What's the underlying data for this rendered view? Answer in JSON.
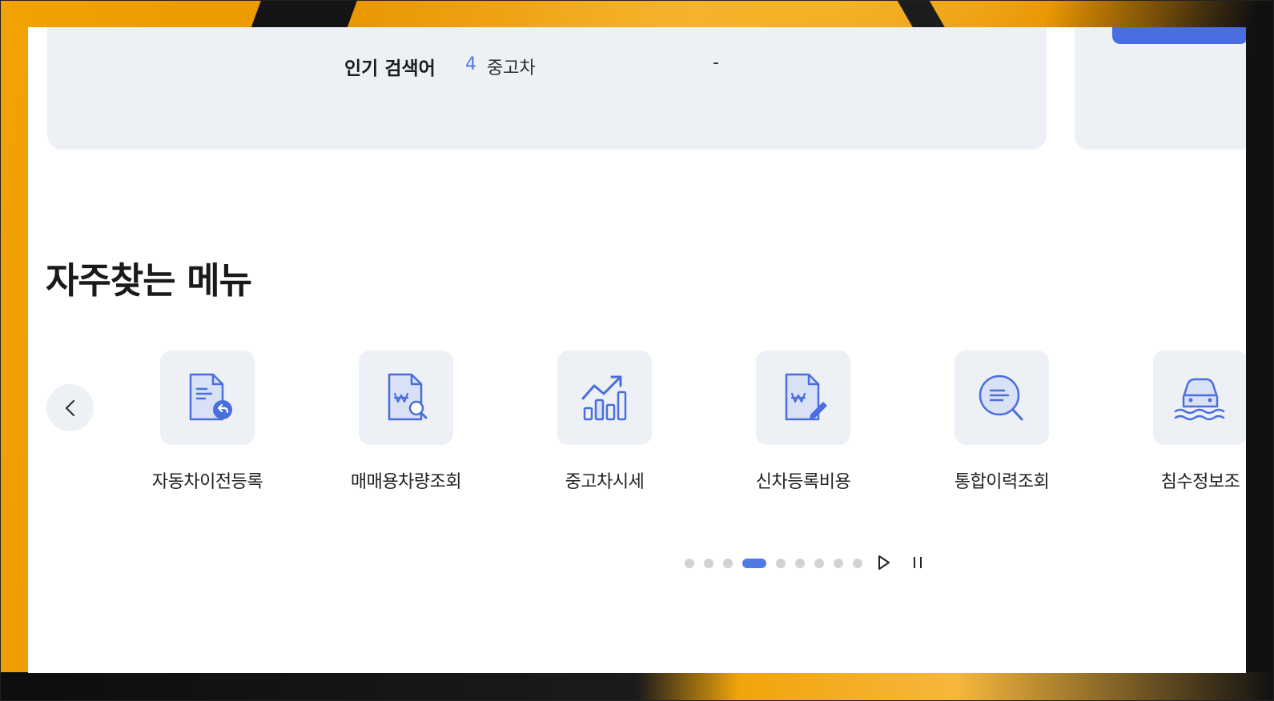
{
  "popular_search": {
    "label": "인기 검색어",
    "rank": "4",
    "term": "중고차",
    "dash": "-"
  },
  "section_title": "자주찾는 메뉴",
  "menu_items": [
    {
      "label": "자동차이전등록",
      "icon": "document-return-icon"
    },
    {
      "label": "매매용차량조회",
      "icon": "document-won-search-icon"
    },
    {
      "label": "중고차시세",
      "icon": "chart-trend-icon"
    },
    {
      "label": "신차등록비용",
      "icon": "document-won-edit-icon"
    },
    {
      "label": "통합이력조회",
      "icon": "search-list-icon"
    },
    {
      "label": "침수정보조",
      "icon": "flooded-car-icon"
    }
  ],
  "pagination": {
    "total": 9,
    "active_index": 3
  },
  "colors": {
    "accent": "#4f7ae6",
    "icon_bg": "#edf0f5",
    "dot_inactive": "#d2d2d2"
  }
}
